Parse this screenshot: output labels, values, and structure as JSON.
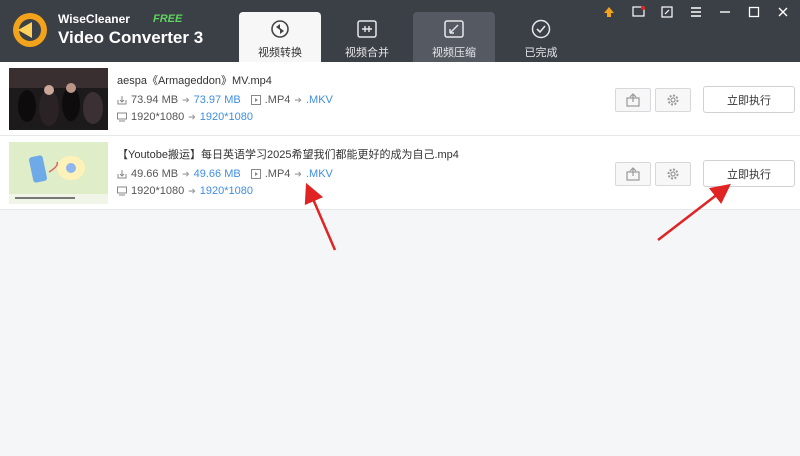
{
  "app": {
    "brand_line1": "WiseCleaner",
    "brand_badge": "FREE",
    "brand_line2": "Video Converter 3"
  },
  "tabs": [
    {
      "label": "视频转换",
      "icon": "convert-icon"
    },
    {
      "label": "视频合并",
      "icon": "merge-icon"
    },
    {
      "label": "视频压缩",
      "icon": "compress-icon"
    },
    {
      "label": "已完成",
      "icon": "done-icon"
    }
  ],
  "window_controls": [
    "upgrade-icon",
    "feedback-icon",
    "edit-icon",
    "menu-icon",
    "minimize-icon",
    "maximize-icon",
    "close-icon"
  ],
  "files": [
    {
      "name": "aespa《Armageddon》MV.mp4",
      "size_from": "73.94 MB",
      "size_to": "73.97 MB",
      "format_from": ".MP4",
      "format_to": ".MKV",
      "res_from": "1920*1080",
      "res_to": "1920*1080",
      "exec_label": "立即执行"
    },
    {
      "name": "【Youtobe搬运】每日英语学习2025希望我们都能更好的成为自己.mp4",
      "size_from": "49.66 MB",
      "size_to": "49.66 MB",
      "format_from": ".MP4",
      "format_to": ".MKV",
      "res_from": "1920*1080",
      "res_to": "1920*1080",
      "exec_label": "立即执行"
    }
  ],
  "colors": {
    "titlebar": "#3b3f46",
    "accent_blue": "#3f8ee0",
    "annotation_red": "#e02424",
    "free_green": "#5fd35f"
  }
}
